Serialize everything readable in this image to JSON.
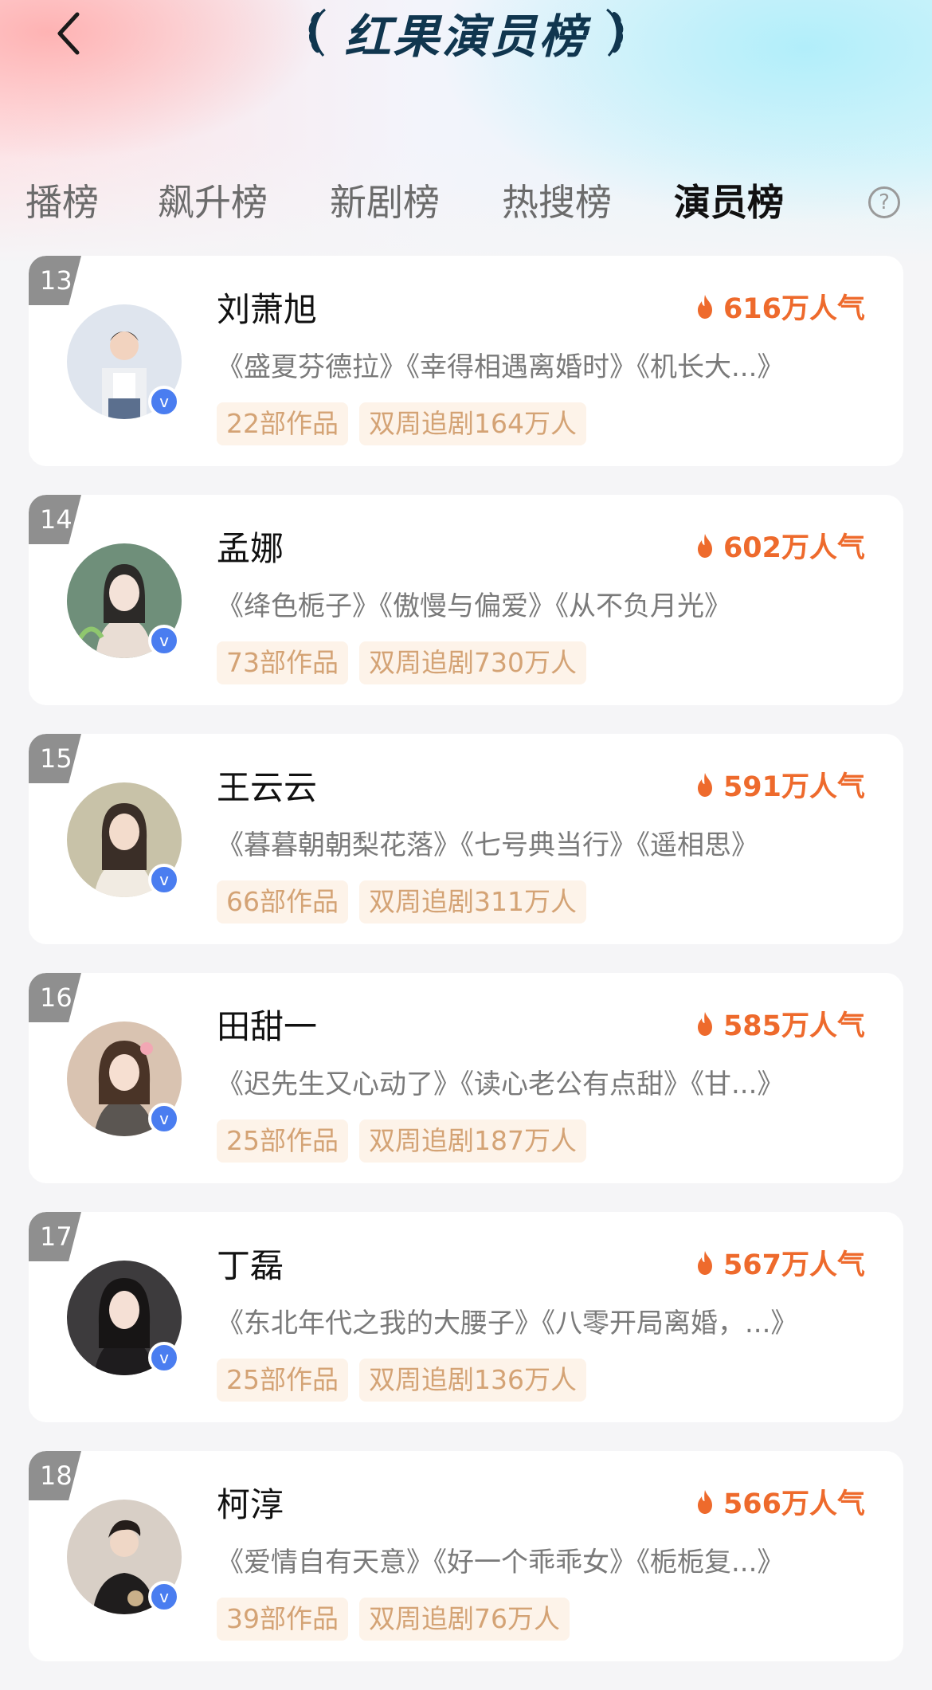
{
  "header": {
    "back_icon": "chevron-left-icon",
    "title": "红果演员榜"
  },
  "tabs": [
    {
      "label": "播榜",
      "active": false
    },
    {
      "label": "飙升榜",
      "active": false
    },
    {
      "label": "新剧榜",
      "active": false
    },
    {
      "label": "热搜榜",
      "active": false
    },
    {
      "label": "演员榜",
      "active": true
    }
  ],
  "help": {
    "icon": "help-circle-icon",
    "label": "?"
  },
  "colors": {
    "title": "#10364f",
    "popularity": "#ee6a2c",
    "tag_text": "#d4a375",
    "tag_bg": "#fdf3e9",
    "rank_bg": "#8f8f8f",
    "verified": "#4a7df0"
  },
  "verified_mark": "v",
  "actors": [
    {
      "rank": "13",
      "name": "刘萧旭",
      "popularity": "616万人气",
      "works": "《盛夏芬德拉》《幸得相遇离婚时》《机长大...》",
      "count": "22部作品",
      "followers": "双周追剧164万人"
    },
    {
      "rank": "14",
      "name": "孟娜",
      "popularity": "602万人气",
      "works": "《绛色栀子》《傲慢与偏爱》《从不负月光》",
      "count": "73部作品",
      "followers": "双周追剧730万人"
    },
    {
      "rank": "15",
      "name": "王云云",
      "popularity": "591万人气",
      "works": "《暮暮朝朝梨花落》《七号典当行》《遥相思》",
      "count": "66部作品",
      "followers": "双周追剧311万人"
    },
    {
      "rank": "16",
      "name": "田甜一",
      "popularity": "585万人气",
      "works": "《迟先生又心动了》《读心老公有点甜》《甘...》",
      "count": "25部作品",
      "followers": "双周追剧187万人"
    },
    {
      "rank": "17",
      "name": "丁磊",
      "popularity": "567万人气",
      "works": "《东北年代之我的大腰子》《八零开局离婚，...》",
      "count": "25部作品",
      "followers": "双周追剧136万人"
    },
    {
      "rank": "18",
      "name": "柯淳",
      "popularity": "566万人气",
      "works": "《爱情自有天意》《好一个乖乖女》《栀栀复...》",
      "count": "39部作品",
      "followers": "双周追剧76万人"
    }
  ]
}
